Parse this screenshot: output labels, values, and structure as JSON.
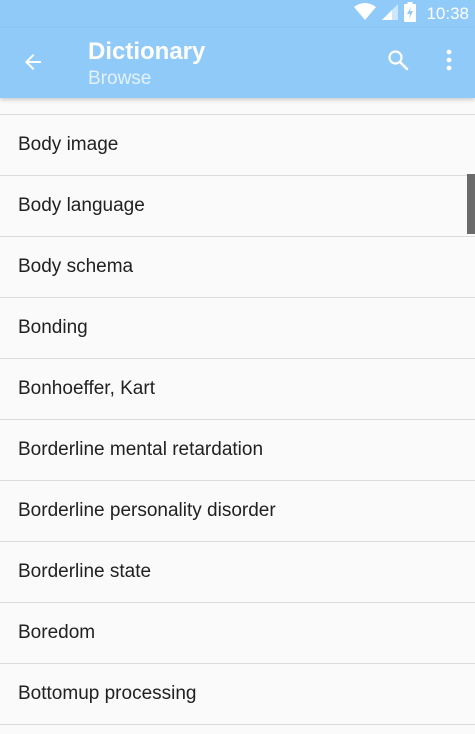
{
  "status_bar": {
    "time": "10:38",
    "icons": [
      "wifi-icon",
      "signal-icon",
      "battery-charging-icon"
    ]
  },
  "app_bar": {
    "title": "Dictionary",
    "subtitle": "Browse",
    "back_icon": "arrow-back-icon",
    "search_icon": "search-icon",
    "more_icon": "more-vert-icon"
  },
  "list": {
    "items": [
      {
        "label": "Body image"
      },
      {
        "label": "Body language"
      },
      {
        "label": "Body schema"
      },
      {
        "label": "Bonding"
      },
      {
        "label": "Bonhoeffer, Kart"
      },
      {
        "label": "Borderline mental retardation"
      },
      {
        "label": "Borderline personality disorder"
      },
      {
        "label": "Borderline state"
      },
      {
        "label": "Boredom"
      },
      {
        "label": "Bottomup processing"
      }
    ]
  },
  "colors": {
    "app_bar": "#90caf9",
    "background": "#fafafa",
    "divider": "#dcdcdc",
    "text": "#212121",
    "scrollbar": "#6b6b6b"
  }
}
